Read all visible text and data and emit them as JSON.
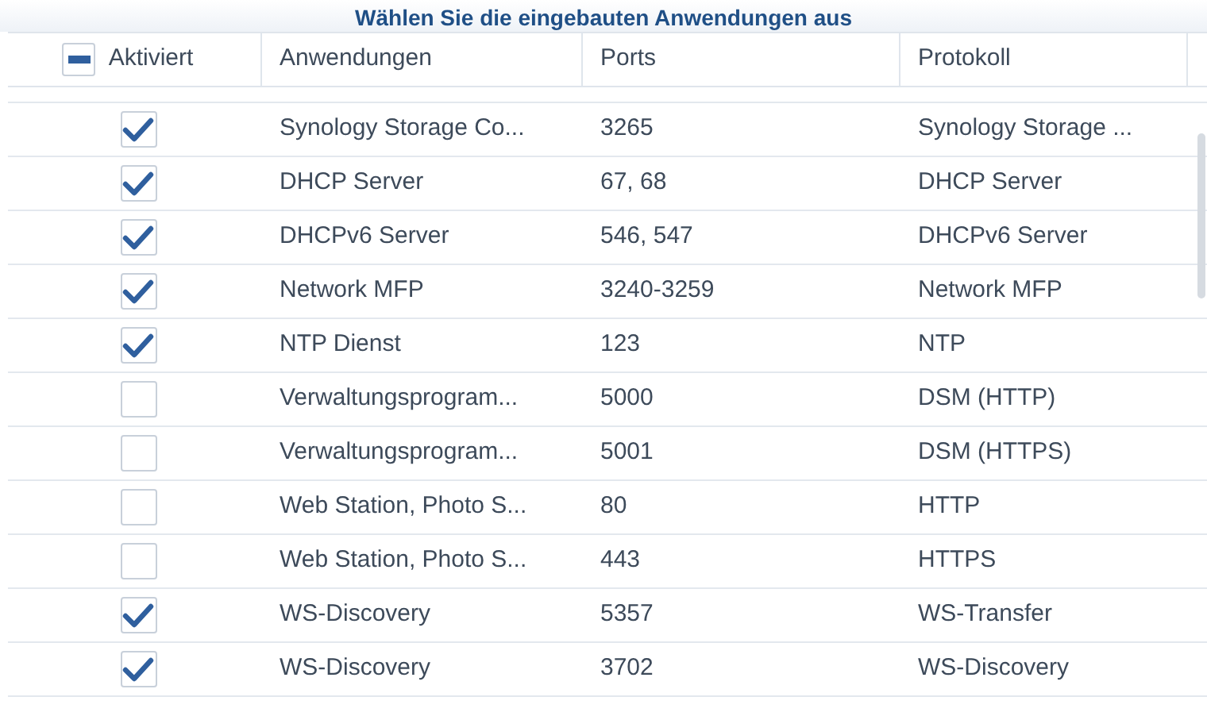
{
  "title": "Wählen Sie die eingebauten Anwendungen aus",
  "header": {
    "select_all": {
      "label": "Aktiviert",
      "indeterminate": true
    },
    "columns": [
      "Anwendungen",
      "Ports",
      "Protokoll"
    ]
  },
  "rows": [
    {
      "checked": true,
      "application": "Synology Storage Co...",
      "ports": "3265",
      "protocol": "Synology Storage ..."
    },
    {
      "checked": true,
      "application": "DHCP Server",
      "ports": "67, 68",
      "protocol": "DHCP Server"
    },
    {
      "checked": true,
      "application": "DHCPv6 Server",
      "ports": "546, 547",
      "protocol": "DHCPv6 Server"
    },
    {
      "checked": true,
      "application": "Network MFP",
      "ports": "3240-3259",
      "protocol": "Network MFP"
    },
    {
      "checked": true,
      "application": "NTP Dienst",
      "ports": "123",
      "protocol": "NTP"
    },
    {
      "checked": false,
      "application": "Verwaltungsprogram...",
      "ports": "5000",
      "protocol": "DSM (HTTP)"
    },
    {
      "checked": false,
      "application": "Verwaltungsprogram...",
      "ports": "5001",
      "protocol": "DSM (HTTPS)"
    },
    {
      "checked": false,
      "application": "Web Station, Photo S...",
      "ports": "80",
      "protocol": "HTTP"
    },
    {
      "checked": false,
      "application": "Web Station, Photo S...",
      "ports": "443",
      "protocol": "HTTPS"
    },
    {
      "checked": true,
      "application": "WS-Discovery",
      "ports": "5357",
      "protocol": "WS-Transfer"
    },
    {
      "checked": true,
      "application": "WS-Discovery",
      "ports": "3702",
      "protocol": "WS-Discovery"
    }
  ]
}
